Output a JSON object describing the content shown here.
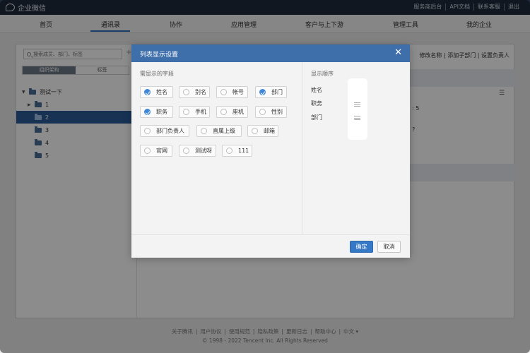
{
  "topbar": {
    "logo_text": "企业微信",
    "links": [
      "服务商后台",
      "API文档",
      "联系客服",
      "退出"
    ]
  },
  "nav": {
    "items": [
      "首页",
      "通讯录",
      "协作",
      "应用管理",
      "客户与上下游",
      "管理工具",
      "我的企业"
    ],
    "active_index": 1
  },
  "left": {
    "search_placeholder": "搜索成员、部门、标签",
    "tabs": [
      "组织架构",
      "标签"
    ],
    "active_tab": 0,
    "tree": [
      {
        "label": "测试一下",
        "level": 0,
        "expanded": true,
        "selected": false
      },
      {
        "label": "1",
        "level": 1,
        "has_children": true,
        "selected": false
      },
      {
        "label": "2",
        "level": 1,
        "selected": true
      },
      {
        "label": "3",
        "level": 1,
        "selected": false
      },
      {
        "label": "4",
        "level": 1,
        "selected": false
      },
      {
        "label": "5",
        "level": 1,
        "selected": false
      }
    ]
  },
  "right": {
    "actions": "修改名称 | 添加子部门 | 设置负责人",
    "fragments": [
      ": 5",
      "?"
    ]
  },
  "dialog": {
    "title": "列表显示设置",
    "fields_label": "需显示的字段",
    "order_label": "显示顺序",
    "fields": [
      {
        "label": "姓名",
        "checked": true
      },
      {
        "label": "别名",
        "checked": false
      },
      {
        "label": "帐号",
        "checked": false
      },
      {
        "label": "部门",
        "checked": true
      },
      {
        "label": "职务",
        "checked": true
      },
      {
        "label": "手机",
        "checked": false
      },
      {
        "label": "座机",
        "checked": false
      },
      {
        "label": "性别",
        "checked": false
      },
      {
        "label": "部门负责人",
        "checked": false
      },
      {
        "label": "直属上级",
        "checked": false
      },
      {
        "label": "邮箱",
        "checked": false
      },
      {
        "label": "官网",
        "checked": false
      },
      {
        "label": "测试呀",
        "checked": false
      },
      {
        "label": "111",
        "checked": false
      }
    ],
    "order": [
      "姓名",
      "职务",
      "部门"
    ],
    "ok_label": "确定",
    "cancel_label": "取消"
  },
  "footer": {
    "links": [
      "关于腾讯",
      "用户协议",
      "使用规范",
      "隐私政策",
      "更新日志",
      "帮助中心",
      "中文 ▾"
    ],
    "copyright": "© 1998 - 2022 Tencent Inc. All Rights Reserved"
  }
}
